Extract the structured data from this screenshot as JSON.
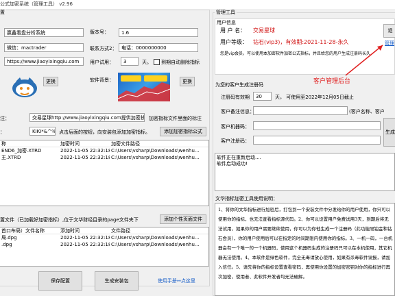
{
  "window": {
    "title": "公式加密系统（管理工具） v2.96"
  },
  "left": {
    "group_title": "置",
    "software_name": "赢鑫看盘分析系统",
    "version_label": "版本号：",
    "version_value": "1.6",
    "wechat": "微信：mactrader",
    "contact_label": "联系方式2：",
    "contact_value": "电话：0000000000",
    "website": "https://www.jiaoyixingqiu.com",
    "trial_label": "用户试用：",
    "trial_value": "3",
    "trial_unit": "天。",
    "auto_delete_label": "到期自动删除指标",
    "change_button_1": "更换",
    "software_bg_label": "软件背景：",
    "change_button_2": "更换",
    "note_label": "注：",
    "note_value": "交易星球http://www.jiaoyixingqiu.com提供加密技术",
    "note_hint": "加密指标文件里面的标注",
    "key_label": "：",
    "key_value": "KIKI*&^%#JDK",
    "key_hint": "点击后面的按钮，向安装包添加加密指标。",
    "add_encrypted_button": "添加加密指标公式",
    "files_table": {
      "headers": [
        "称",
        "加密时间",
        "加密文件路径"
      ],
      "rows": [
        [
          "END6_加密.XTRD",
          "2022-11-05 22:32:18",
          "C:\\Users\\vsharp\\Downloads\\wenhu..."
        ],
        [
          "王.XTRD",
          "2022-11-05 22:32:18",
          "C:\\Users\\vsharp\\Downloads\\wenhu..."
        ]
      ]
    },
    "page_section_label": "置文件（已加载好加密指标）,位于文华财经目录的page文件夹下",
    "add_page_button": "添加个性页面文件",
    "pages_table": {
      "headers": [
        "首口布局）文件名称",
        "添加时间",
        "文件路径"
      ],
      "rows": [
        [
          "局.dpg",
          "2022-11-05 22:32:18",
          "C:\\Users\\vsharp\\Downloads\\wenhu..."
        ],
        [
          ".dpg",
          "2022-11-05 22:32:18",
          "C:\\Users\\vsharp\\Downloads\\wenhu..."
        ]
      ]
    },
    "save_button": "保存配置",
    "build_button": "生成安装包",
    "manual_link": "使用手册↔点这里"
  },
  "right": {
    "group_title": "管理工具",
    "user_info_title": "用户信息",
    "user_name_label": "用 户 名：",
    "user_name_value": "交易星球",
    "user_level_label": "用户等级：",
    "user_level_value": "钻石(vip3)，有效期:2021-11-28-永久",
    "vip_note": "您是vip会员，可以使用本加密软件加密公式指标，并且给您的用户生成注册码长久",
    "top_button": "退",
    "manage_link": "管理",
    "annotation": "客户管理后台",
    "reg_title": "为您的客户生成注册码",
    "reg_days_label": "注册码有效期",
    "reg_days_value": "30",
    "reg_days_hint": "天，  可使用至2022年12月05日截止",
    "customer_note_label": "客户备注信息：",
    "customer_note_hint": "(客户名称、客户",
    "machine_code_label": "客户机器码：",
    "reg_code_label": "客户注册码：",
    "generate_button": "生成",
    "log_lines": [
      "软件正在重新启动....",
      "软件启动成功!"
    ],
    "help_title": "文华指标加密工具使用说明：",
    "help_text": "1、将你的文华指标进行加密后，打包到一个安装文件中分发给你的用户使用，你只可以使用你的指标，也无法查看指标源代码。2、你可以设置用户免费试用3天，到期后将无法试用，如果你的用户需要继续使用，你可以为你他生成一个注册码（此功能限铂金和钻石会员），你的用户使用后可以在指定的时间期限内使用你的指标。3、一机一码，一台机器会有一个唯一的一个机器码，使用这个机器码生成的注册码只可以在本机使用，其它机器无法使用。4、本软件是绿色软件，完全无毒请放心使用，如果有杀毒软件误报，请加入信任。5、请先将你的指标设置查看密码，再使用你设置的加密密钥对你的指标进行再次加密，使用者、此软件开发者均无法破解。"
  },
  "colors": {
    "accent_red": "#e02020",
    "link_blue": "#1a5fc8",
    "vip_red": "#d01010"
  }
}
